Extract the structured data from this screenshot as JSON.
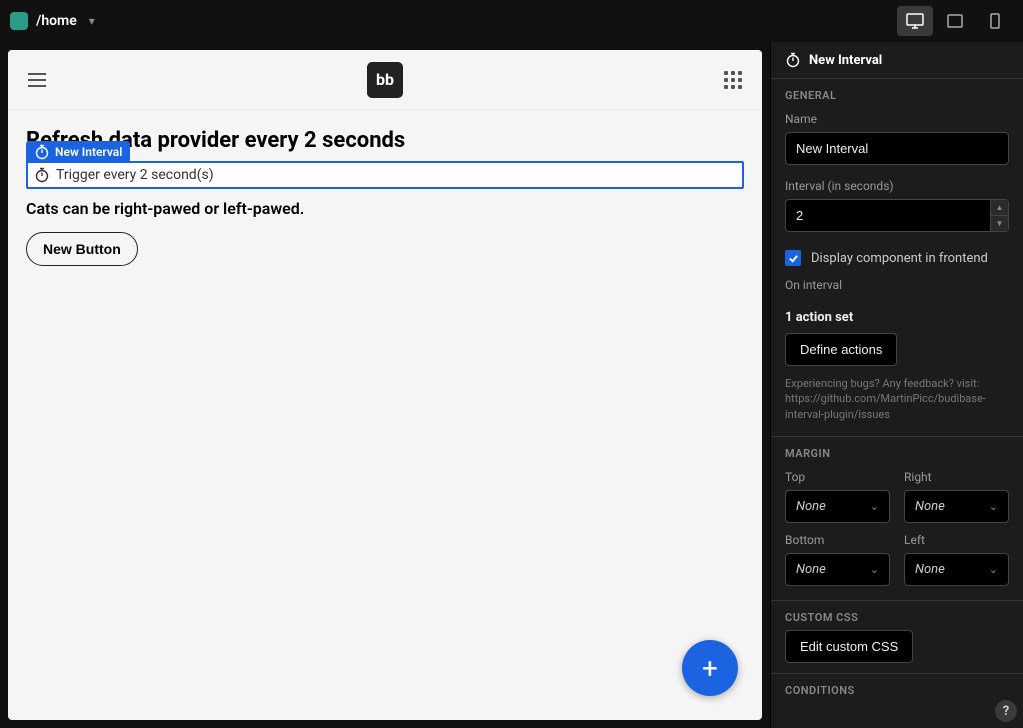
{
  "topbar": {
    "breadcrumb": "/home"
  },
  "canvas": {
    "logo_text": "bb",
    "heading": "Refresh data provider every 2 seconds",
    "selected_tag": "New Interval",
    "trigger_text": "Trigger every 2 second(s)",
    "body_text": "Cats can be right-pawed or left-pawed.",
    "new_button": "New Button"
  },
  "panel": {
    "title": "New Interval",
    "sections": {
      "general": "GENERAL",
      "margin": "MARGIN",
      "custom_css": "CUSTOM CSS",
      "conditions": "CONDITIONS"
    },
    "name_label": "Name",
    "name_value": "New Interval",
    "interval_label": "Interval (in seconds)",
    "interval_value": "2",
    "display_checkbox_label": "Display component in frontend",
    "on_interval_label": "On interval",
    "action_set_text": "1 action set",
    "define_actions": "Define actions",
    "help_text": "Experiencing bugs? Any feedback? visit: https://github.com/MartinPicc/budibase-interval-plugin/issues",
    "margin": {
      "top_label": "Top",
      "right_label": "Right",
      "bottom_label": "Bottom",
      "left_label": "Left",
      "top_value": "None",
      "right_value": "None",
      "bottom_value": "None",
      "left_value": "None"
    },
    "edit_css": "Edit custom CSS"
  }
}
